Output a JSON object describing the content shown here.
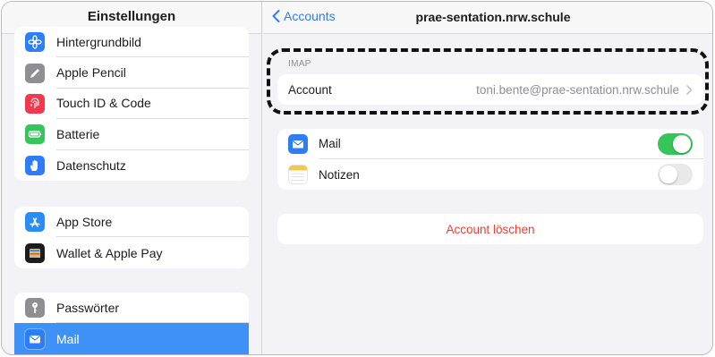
{
  "sidebar": {
    "title": "Einstellungen",
    "group1": [
      {
        "label": "Hintergrundbild",
        "icon": "wallpaper-icon",
        "color": "#2d7ff7"
      },
      {
        "label": "Apple Pencil",
        "icon": "pencil-icon",
        "color": "#8e8e93"
      },
      {
        "label": "Touch ID & Code",
        "icon": "fingerprint-icon",
        "color": "#f2384e"
      },
      {
        "label": "Batterie",
        "icon": "battery-icon",
        "color": "#35c659"
      },
      {
        "label": "Datenschutz",
        "icon": "hand-icon",
        "color": "#2e7cf6"
      }
    ],
    "group2": [
      {
        "label": "App Store",
        "icon": "app-store-icon",
        "color": "#2a8cf7"
      },
      {
        "label": "Wallet & Apple Pay",
        "icon": "wallet-icon",
        "color": "#1c1c1e"
      }
    ],
    "group3": [
      {
        "label": "Passwörter",
        "icon": "key-icon",
        "color": "#8e8e93"
      },
      {
        "label": "Mail",
        "icon": "mail-icon",
        "color": "#2e7cf6",
        "selected": true
      }
    ]
  },
  "detail": {
    "back_label": "Accounts",
    "title": "prae-sentation.nrw.schule",
    "section_label": "IMAP",
    "account_key": "Account",
    "account_value": "toni.bente@prae-sentation.nrw.schule",
    "toggles": [
      {
        "label": "Mail",
        "icon": "mail-icon",
        "on": true
      },
      {
        "label": "Notizen",
        "icon": "notes-icon",
        "on": false
      }
    ],
    "delete_label": "Account löschen"
  },
  "colors": {
    "accent": "#2f7cf6",
    "destructive": "#ef3d33",
    "toggle_on": "#35c659",
    "selection": "#3e91f7"
  }
}
